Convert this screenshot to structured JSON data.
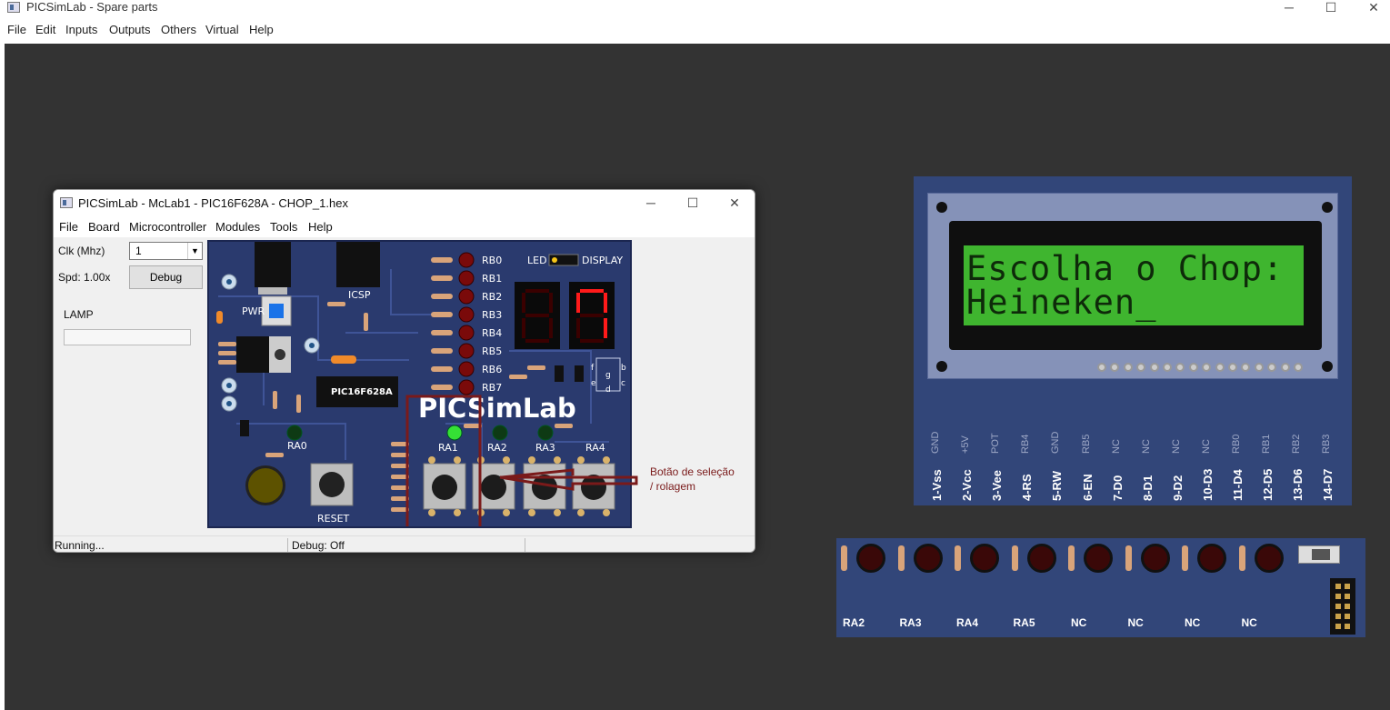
{
  "outer_window": {
    "title": "PICSimLab - Spare parts",
    "menu": [
      "File",
      "Edit",
      "Inputs",
      "Outputs",
      "Others",
      "Virtual",
      "Help"
    ],
    "controls": [
      "─",
      "☐",
      "✕"
    ]
  },
  "inner_window": {
    "title": "PICSimLab - McLab1 - PIC16F628A - CHOP_1.hex",
    "menu": [
      "File",
      "Board",
      "Microcontroller",
      "Modules",
      "Tools",
      "Help"
    ],
    "controls": [
      "─",
      "☐",
      "✕"
    ],
    "clk_label": "Clk (Mhz)",
    "clk_value": "1",
    "spd_label": "Spd: 1.00x",
    "debug_button": "Debug",
    "lamp_label": "LAMP",
    "status": [
      "Running...",
      "Debug: Off",
      ""
    ]
  },
  "board": {
    "logo": "PICSimLab",
    "chip": "PIC16F628A",
    "icsp": "ICSP",
    "pwr": "PWR",
    "reset": "RESET",
    "led_label": "LED",
    "display_label": "DISPLAY",
    "rb_labels": [
      "RB0",
      "RB1",
      "RB2",
      "RB3",
      "RB4",
      "RB5",
      "RB6",
      "RB7"
    ],
    "ra_leds": [
      "RA0",
      "RA1",
      "RA2",
      "RA3",
      "RA4"
    ],
    "segment_letters": [
      "f",
      "g",
      "b",
      "e",
      "d",
      "c"
    ],
    "colors": {
      "pcb": "#2a3a6e",
      "led_on": "#35e035",
      "led_off": "#0e3a14",
      "rb_led": "#7a0a0a",
      "seg_on": "#ff1a1a"
    }
  },
  "annotation": {
    "text_line1": "Botão de seleção",
    "text_line2": "/ rolagem",
    "color": "#7a1a1a"
  },
  "lcd": {
    "line1": "Escolha o Chop:",
    "line2": "Heineken_",
    "pins": [
      {
        "main": "1-Vss",
        "sub": "GND"
      },
      {
        "main": "2-Vcc",
        "sub": "+5V"
      },
      {
        "main": "3-Vee",
        "sub": "POT"
      },
      {
        "main": "4-RS",
        "sub": "RB4"
      },
      {
        "main": "5-RW",
        "sub": "GND"
      },
      {
        "main": "6-EN",
        "sub": "RB5"
      },
      {
        "main": "7-D0",
        "sub": "NC"
      },
      {
        "main": "8-D1",
        "sub": "NC"
      },
      {
        "main": "9-D2",
        "sub": "NC"
      },
      {
        "main": "10-D3",
        "sub": "NC"
      },
      {
        "main": "11-D4",
        "sub": "RB0"
      },
      {
        "main": "12-D5",
        "sub": "RB1"
      },
      {
        "main": "13-D6",
        "sub": "RB2"
      },
      {
        "main": "14-D7",
        "sub": "RB3"
      }
    ],
    "colors": {
      "screen": "#3fb52f",
      "text": "#0e2a0a"
    }
  },
  "led_bar": {
    "labels": [
      "RA2",
      "RA3",
      "RA4",
      "RA5",
      "NC",
      "NC",
      "NC",
      "NC"
    ]
  }
}
